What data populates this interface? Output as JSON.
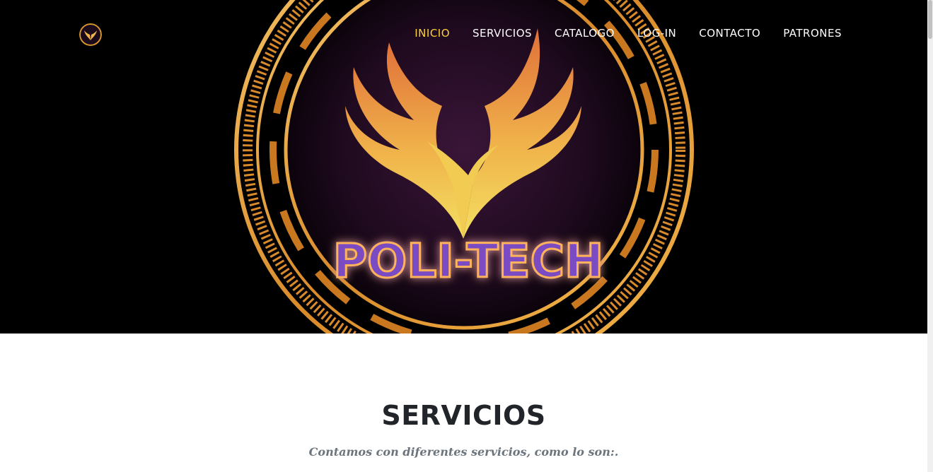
{
  "brand": {
    "logo_alt": "POLI-TECH",
    "emblem_wordmark": "POLI-TECH"
  },
  "nav": {
    "items": [
      {
        "label": "INICIO",
        "active": true
      },
      {
        "label": "SERVICIOS",
        "active": false
      },
      {
        "label": "CATALOGO",
        "active": false
      },
      {
        "label": "LOG-IN",
        "active": false
      },
      {
        "label": "CONTACTO",
        "active": false
      },
      {
        "label": "PATRONES",
        "active": false
      }
    ]
  },
  "services": {
    "heading": "SERVICIOS",
    "subheading": "Contamos con diferentes servicios, como lo son:."
  },
  "colors": {
    "accent": "#fed136",
    "hero_bg": "#000000",
    "ring_gold": "#e8a33a",
    "wordmark_purple": "#7a4cc2",
    "wordmark_glow": "#ff9a3c"
  }
}
